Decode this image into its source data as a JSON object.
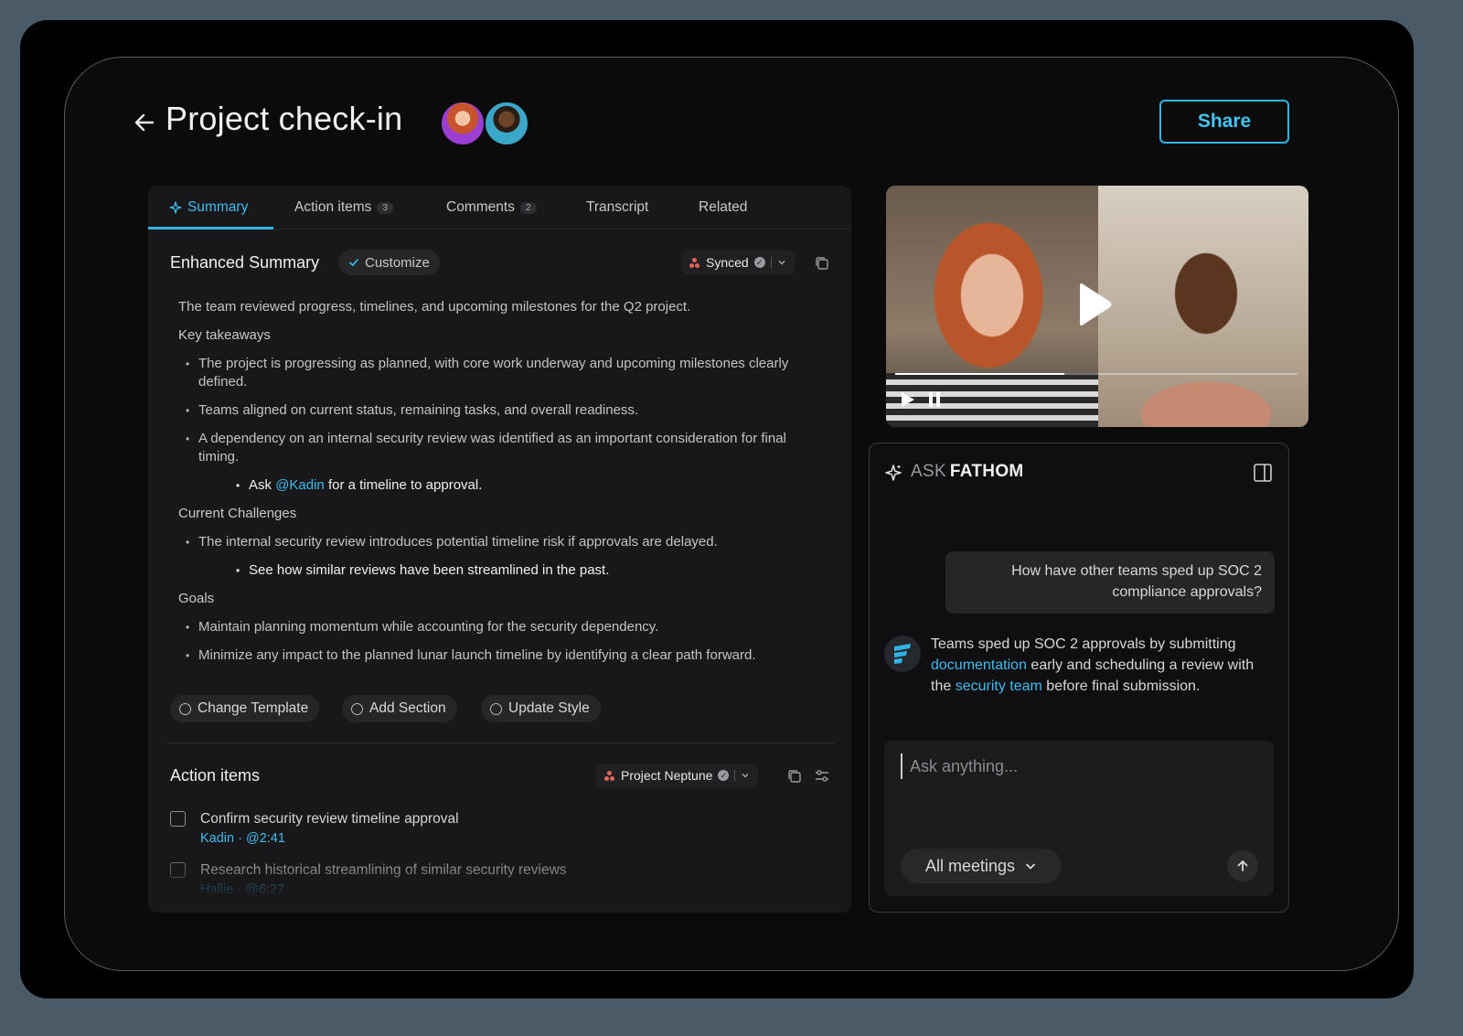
{
  "header": {
    "title": "Project check-in",
    "share_label": "Share"
  },
  "tabs": [
    {
      "label": "Summary",
      "badge": ""
    },
    {
      "label": "Action items",
      "badge": "3"
    },
    {
      "label": "Comments",
      "badge": "2"
    },
    {
      "label": "Transcript",
      "badge": ""
    },
    {
      "label": "Related",
      "badge": ""
    }
  ],
  "summary": {
    "title": "Enhanced Summary",
    "customize_label": "Customize",
    "sync_label": "Synced",
    "lead": "The team reviewed progress, timelines, and upcoming milestones for the Q2 project.",
    "key_takeaways_heading": "Key takeaways",
    "key_takeaways": [
      "The project is progressing as planned, with core work underway and upcoming milestones clearly defined.",
      "Teams aligned on current status, remaining tasks, and overall readiness.",
      "A dependency on an internal security review was identified as an important consideration for final timing."
    ],
    "sub_item_ask_prefix": "Ask",
    "sub_item_mention": "@Kadin",
    "sub_item_ask_suffix": "for a timeline to approval.",
    "challenges_heading": "Current Challenges",
    "challenges": [
      "The internal security review introduces potential timeline risk if approvals are delayed."
    ],
    "challenge_sub": "See how similar reviews have been streamlined in the past.",
    "goals_heading": "Goals",
    "goals": [
      "Maintain planning momentum while accounting for the security dependency.",
      "Minimize any impact to the planned lunar launch timeline by identifying a clear path forward."
    ],
    "template_buttons": [
      "Change Template",
      "Add Section",
      "Update Style"
    ]
  },
  "action_items": {
    "title": "Action items",
    "project_label": "Project Neptune",
    "items": [
      {
        "text": "Confirm security review timeline approval",
        "meta": "Kadin · @2:41"
      },
      {
        "text": "Research historical streamlining of similar security reviews",
        "meta": "Hallie · @6:27"
      }
    ]
  },
  "video": {
    "progress": 0.42
  },
  "ask_fathom": {
    "title_prefix": "ASK",
    "title_brand": "FATHOM",
    "user_message": "How have other teams sped up SOC 2 compliance approvals?",
    "reply_part1": "Teams sped up SOC 2 approvals by submitting",
    "reply_link1": "documentation",
    "reply_part2": "early and scheduling a review with the",
    "reply_link2": "security team",
    "reply_part3": "before final submission.",
    "input_placeholder": "Ask anything...",
    "scope_label": "All meetings"
  },
  "colors": {
    "accent": "#2fb6e6",
    "background": "#0b0b0c",
    "panel": "#18181a",
    "sync_dot": "#e5625c"
  },
  "icons": [
    "back-arrow-icon",
    "sparkle-icon",
    "check-icon",
    "copy-icon",
    "filter-icon",
    "play-icon",
    "pause-icon",
    "sidebar-panel-icon",
    "chevron-down-icon",
    "arrow-up-icon"
  ]
}
